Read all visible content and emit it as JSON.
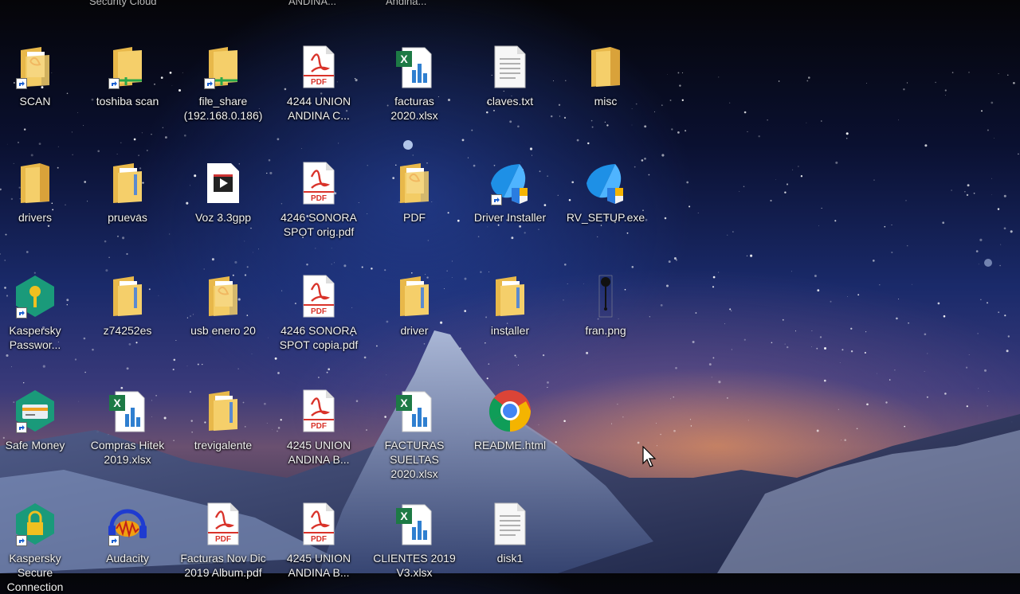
{
  "desktop": {
    "top_partial": [
      "Security Cloud",
      "ANDINA...",
      "Andina..."
    ],
    "icons": [
      {
        "label": "SCAN",
        "type": "pdf-folder"
      },
      {
        "label": "toshiba scan",
        "type": "folder-net"
      },
      {
        "label": "file_share (192.168.0.186)",
        "type": "folder-net"
      },
      {
        "label": "4244 UNION ANDINA C...",
        "type": "pdf"
      },
      {
        "label": "facturas 2020.xlsx",
        "type": "excel"
      },
      {
        "label": "claves.txt",
        "type": "txt"
      },
      {
        "label": "misc",
        "type": "folder"
      },
      {
        "label": "drivers",
        "type": "folder"
      },
      {
        "label": "pruevas",
        "type": "folder-doc"
      },
      {
        "label": "Voz 3.3gpp",
        "type": "video"
      },
      {
        "label": "4246 SONORA SPOT orig.pdf",
        "type": "pdf"
      },
      {
        "label": "PDF",
        "type": "pdf-folder"
      },
      {
        "label": "Driver Installer",
        "type": "installer"
      },
      {
        "label": "RV_SETUP.exe",
        "type": "installer"
      },
      {
        "label": "Kaspersky Passwor...",
        "type": "kaspersky-pw"
      },
      {
        "label": "z74252es",
        "type": "folder-doc"
      },
      {
        "label": "usb enero 20",
        "type": "pdf-folder"
      },
      {
        "label": "4246 SONORA SPOT copia.pdf",
        "type": "pdf"
      },
      {
        "label": "driver",
        "type": "folder-doc"
      },
      {
        "label": "installer",
        "type": "folder-doc"
      },
      {
        "label": "fran.png",
        "type": "image"
      },
      {
        "label": "Safe Money",
        "type": "safe-money"
      },
      {
        "label": "Compras Hitek 2019.xlsx",
        "type": "excel"
      },
      {
        "label": "trevigalente",
        "type": "folder-doc"
      },
      {
        "label": "4245 UNION ANDINA B...",
        "type": "pdf"
      },
      {
        "label": "FACTURAS SUELTAS 2020.xlsx",
        "type": "excel"
      },
      {
        "label": "README.html",
        "type": "chrome"
      },
      {
        "label": "Kaspersky Secure Connection",
        "type": "kaspersky-sc"
      },
      {
        "label": "Audacity",
        "type": "audacity"
      },
      {
        "label": "Facturas Nov Dic 2019 Album.pdf",
        "type": "pdf"
      },
      {
        "label": "4245 UNION ANDINA B...",
        "type": "pdf"
      },
      {
        "label": "CLIENTES 2019 V3.xlsx",
        "type": "excel"
      },
      {
        "label": "disk1",
        "type": "txt"
      }
    ]
  },
  "colors": {
    "folder": "#e8b84a",
    "pdf_red": "#d9332a",
    "excel_green": "#1d7a45",
    "installer_blue": "#1e90e6",
    "kaspersky_green": "#1a9a7a"
  }
}
